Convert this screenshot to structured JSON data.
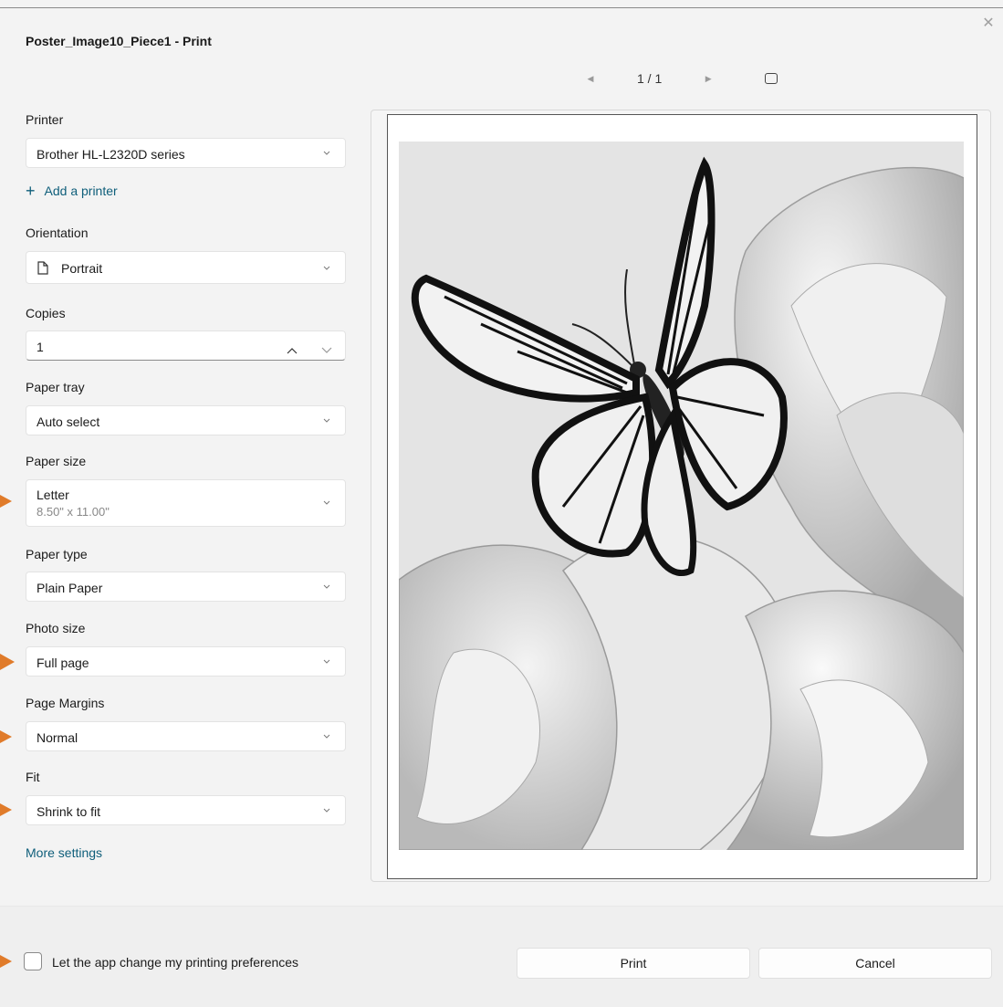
{
  "window": {
    "title": "Poster_Image10_Piece1 - Print"
  },
  "preview": {
    "page_counter": "1 / 1"
  },
  "printer": {
    "label": "Printer",
    "value": "Brother HL-L2320D series",
    "add_printer": "Add a printer"
  },
  "orientation": {
    "label": "Orientation",
    "value": "Portrait"
  },
  "copies": {
    "label": "Copies",
    "value": "1"
  },
  "paper_tray": {
    "label": "Paper tray",
    "value": "Auto select"
  },
  "paper_size": {
    "label": "Paper size",
    "value": "Letter",
    "subvalue": "8.50\" x 11.00\""
  },
  "paper_type": {
    "label": "Paper type",
    "value": "Plain Paper"
  },
  "photo_size": {
    "label": "Photo size",
    "value": "Full page"
  },
  "page_margins": {
    "label": "Page Margins",
    "value": "Normal"
  },
  "fit": {
    "label": "Fit",
    "value": "Shrink to fit"
  },
  "more_settings": "More settings",
  "footer": {
    "preferences_label": "Let the app change my printing preferences",
    "print_button": "Print",
    "cancel_button": "Cancel"
  },
  "colors": {
    "accent_link": "#0e5e7a",
    "marker": "#e07b2a"
  }
}
